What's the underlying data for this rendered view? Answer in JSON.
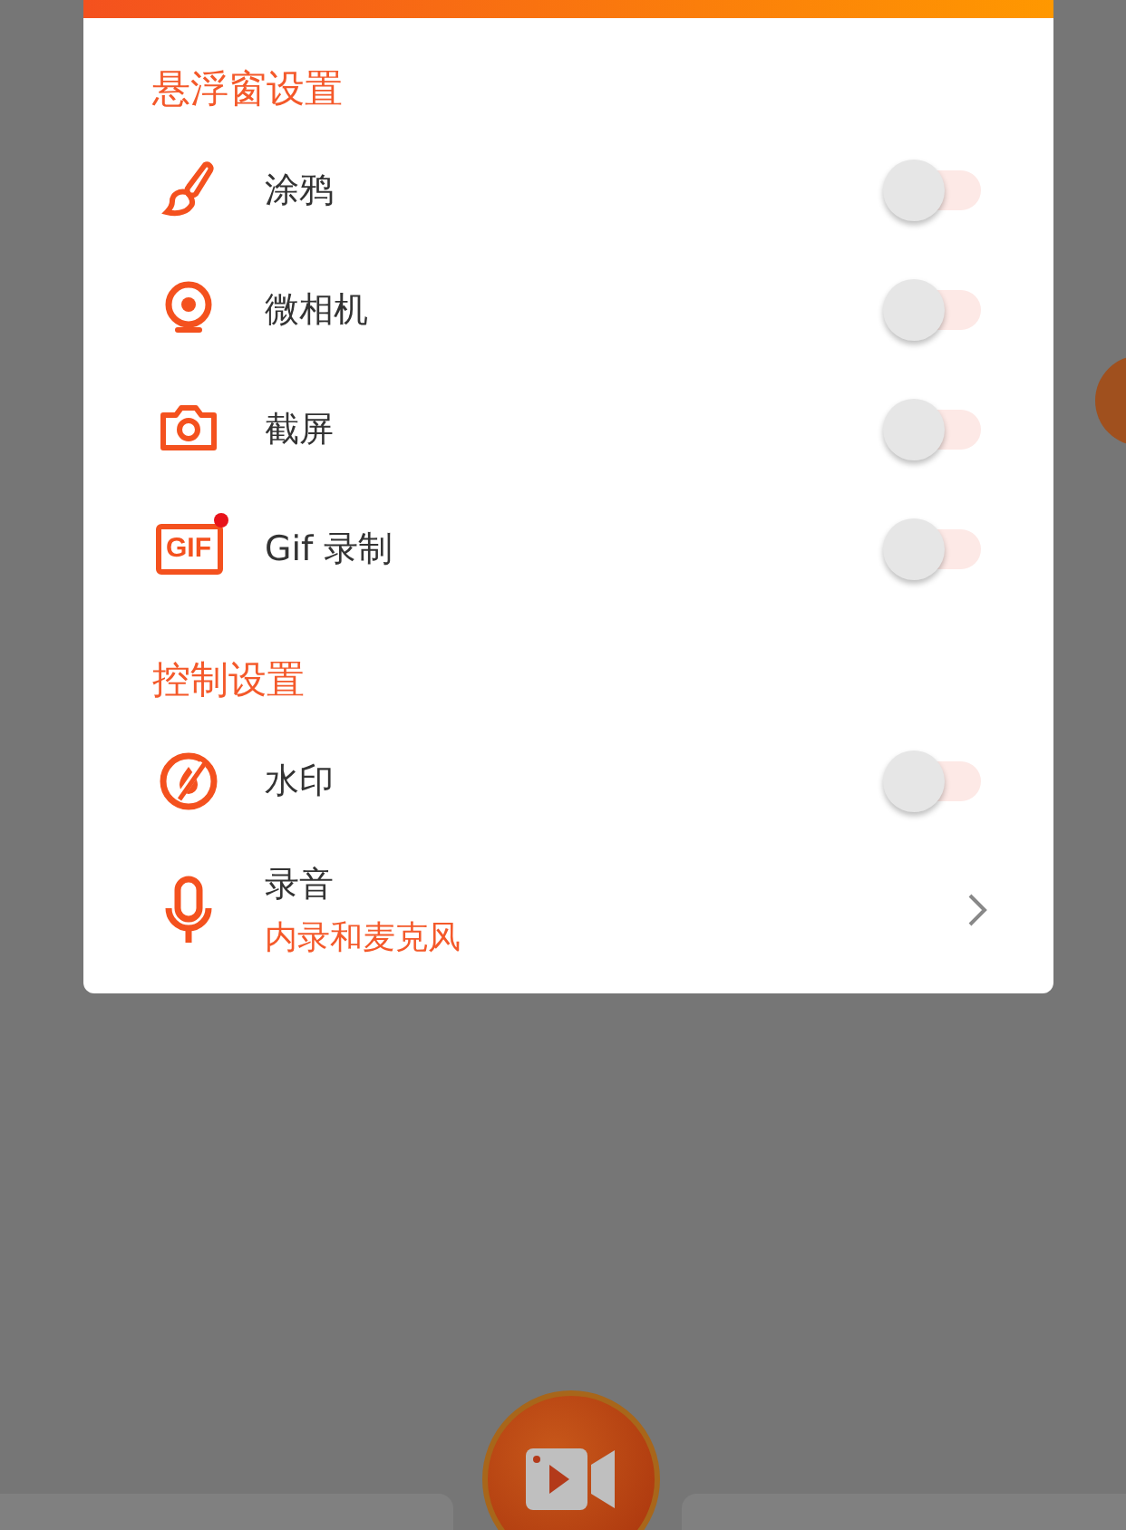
{
  "sections": [
    {
      "title": "悬浮窗设置",
      "items": [
        {
          "kind": "toggle",
          "label": "涂鸦",
          "on": false,
          "new": false
        },
        {
          "kind": "toggle",
          "label": "微相机",
          "on": false,
          "new": false
        },
        {
          "kind": "toggle",
          "label": "截屏",
          "on": false,
          "new": false
        },
        {
          "kind": "toggle",
          "icon_text": "GIF",
          "label": "Gif 录制",
          "on": false,
          "new": true
        }
      ]
    },
    {
      "title": "控制设置",
      "items": [
        {
          "kind": "toggle",
          "label": "水印",
          "on": false,
          "new": false
        },
        {
          "kind": "link",
          "label": "录音",
          "value": "内录和麦克风"
        }
      ]
    }
  ]
}
